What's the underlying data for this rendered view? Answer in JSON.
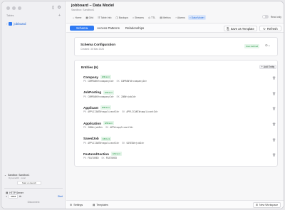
{
  "sidebar": {
    "section_label": "Tables",
    "add_icon": "+",
    "table_item": "jobboard",
    "connection": {
      "name": "Sandbox: Sandbox1",
      "detail": "DynamoDb · local",
      "launch_label": "Start on launch"
    },
    "server": {
      "label": "HTTP Server",
      "port": "8888",
      "start_label": "Start"
    },
    "disconnect_label": "Disconnect"
  },
  "header": {
    "title": "jobboard – Data Model",
    "subtitle": "Sandbox: Sandbox1",
    "read_only_label": "Read only",
    "tabs": [
      {
        "icon": "home-icon",
        "glyph": "⌂",
        "label": "Home"
      },
      {
        "icon": "grid-icon",
        "glyph": "▦",
        "label": "Grid"
      },
      {
        "icon": "table-icon",
        "glyph": "☷",
        "label": "Table Info"
      },
      {
        "icon": "backups-icon",
        "glyph": "◫",
        "label": "Backups"
      },
      {
        "icon": "streams-icon",
        "glyph": "≈",
        "label": "Streams"
      },
      {
        "icon": "ttl-icon",
        "glyph": "◷",
        "label": "TTL"
      },
      {
        "icon": "metrics-icon",
        "glyph": "▤",
        "label": "Metrics"
      },
      {
        "icon": "alarms-icon",
        "glyph": "◔",
        "label": "Alarms"
      },
      {
        "icon": "data-model-icon",
        "glyph": "⌗",
        "label": "Data Model",
        "active": true
      }
    ]
  },
  "subbar": {
    "tabs": [
      "Schema",
      "Access Patterns",
      "Relationships"
    ],
    "save_template_label": "Save as Template",
    "refresh_label": "Refresh"
  },
  "config": {
    "title": "Schema Configuration",
    "created": "Created: 30 Mar 2026",
    "badge": "User-defined"
  },
  "entities": {
    "title": "Entities (6)",
    "add_label": "Add Entity",
    "items": [
      {
        "name": "Company",
        "badge": "Efficient",
        "pk": "COMPANY#<companyId>",
        "sk": "COMPANY#<companyId>"
      },
      {
        "name": "JobPosting",
        "badge": "Efficient",
        "pk": "COMPANY#<companyId>",
        "sk": "JOB#<jobId>"
      },
      {
        "name": "Applicant",
        "badge": "Efficient",
        "pk": "APPLICANT#<applicantId>",
        "sk": "APPLICANT#<applicantId>"
      },
      {
        "name": "Application",
        "badge": "Efficient",
        "pk": "JOB#<jobId>",
        "sk": "APP#<applicantId>"
      },
      {
        "name": "SavedJob",
        "badge": "Efficient",
        "pk": "APPLICANT#<applicantId>",
        "sk": "SAVED#<jobId>"
      },
      {
        "name": "FeaturedSection",
        "badge": "Efficient",
        "pk": "FEATURED",
        "sk": "FEATURED"
      }
    ]
  },
  "footer": {
    "settings_label": "Settings",
    "templates_label": "Templates",
    "new_workspace_label": "New Workspace"
  }
}
